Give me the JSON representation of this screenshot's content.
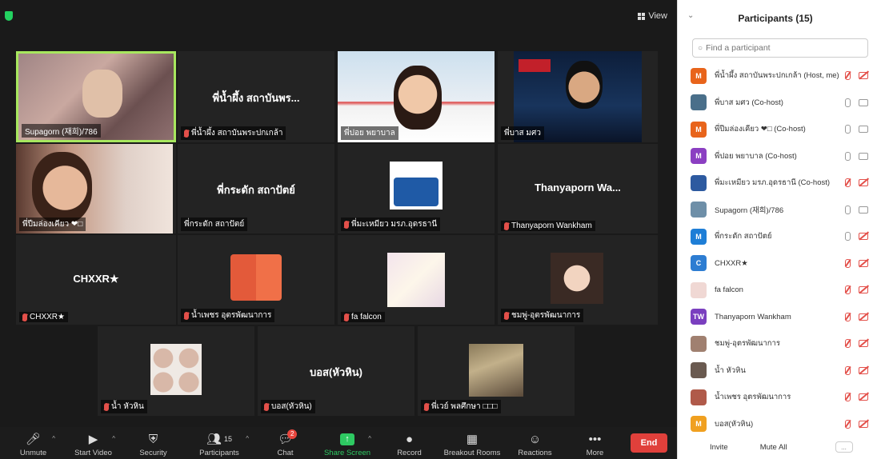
{
  "video": {
    "view_label": "View",
    "tiles": [
      {
        "name": "Supagorn (재희)/786",
        "big": "",
        "muted": false
      },
      {
        "name": "พี่น้ำผึ้ง สถาบันพระปกเกล้า",
        "big": "พี่น้ำผึ้ง สถาบันพร...",
        "muted": true
      },
      {
        "name": "พี่ปอย พยาบาล",
        "big": "",
        "muted": false
      },
      {
        "name": "พี่บาส มศว",
        "big": "",
        "muted": false
      },
      {
        "name": "พี่ปีมล่องเคียว ❤□",
        "big": "",
        "muted": false
      },
      {
        "name": "พี่กระดัก สถาปัตย์",
        "big": "พี่กระดัก สถาปัตย์",
        "muted": false
      },
      {
        "name": "พี่มะเหมียว มรภ.อุดรธานี",
        "big": "",
        "muted": true
      },
      {
        "name": "Thanyaporn Wankham",
        "big": "Thanyaporn  Wa...",
        "muted": true
      },
      {
        "name": "CHXXR★",
        "big": "CHXXR★",
        "muted": true
      },
      {
        "name": "น้ำเพชร อุตรพัฒนาการ",
        "big": "",
        "muted": true
      },
      {
        "name": "fa falcon",
        "big": "",
        "muted": true
      },
      {
        "name": "ชมพู่-อุตรพัฒนาการ",
        "big": "",
        "muted": true
      },
      {
        "name": "น้ำ หัวหิน",
        "big": "",
        "muted": true
      },
      {
        "name": "บอส(หัวหิน)",
        "big": "บอส(หัวหิน)",
        "muted": true
      },
      {
        "name": "พี่เวย์ พลศึกษา □□□",
        "big": "",
        "muted": true
      }
    ]
  },
  "toolbar": {
    "unmute": "Unmute",
    "start_video": "Start Video",
    "security": "Security",
    "participants": "Participants",
    "participants_count": "15",
    "chat": "Chat",
    "chat_badge": "2",
    "share_screen": "Share Screen",
    "record": "Record",
    "breakout": "Breakout Rooms",
    "reactions": "Reactions",
    "more": "More",
    "end": "End"
  },
  "panel": {
    "title": "Participants (15)",
    "search_placeholder": "Find a participant",
    "participants": [
      {
        "name": "พี่น้ำผึ้ง สถาบันพระปกเกล้า (Host, me)",
        "avatar": "M",
        "color": "#e8641b",
        "mic": "off",
        "cam": "off"
      },
      {
        "name": "พี่บาส มศว (Co-host)",
        "avatar": "",
        "color": "#4a6f8a",
        "mic": "on",
        "cam": "on"
      },
      {
        "name": "พี่ปีมล่องเคียว ❤□ (Co-host)",
        "avatar": "M",
        "color": "#e8641b",
        "mic": "on",
        "cam": "on"
      },
      {
        "name": "พี่ปอย พยาบาล (Co-host)",
        "avatar": "M",
        "color": "#8b3fc2",
        "mic": "on",
        "cam": "on"
      },
      {
        "name": "พี่มะเหมียว มรภ.อุดรธานี (Co-host)",
        "avatar": "",
        "color": "#2d5aa0",
        "mic": "off",
        "cam": "off"
      },
      {
        "name": "Supagorn (재희)/786",
        "avatar": "",
        "color": "#6e8fa8",
        "mic": "on",
        "cam": "on"
      },
      {
        "name": "พี่กระดัก สถาปัตย์",
        "avatar": "M",
        "color": "#1e7ed6",
        "mic": "on",
        "cam": "off"
      },
      {
        "name": "CHXXR★",
        "avatar": "C",
        "color": "#2d7dd2",
        "mic": "off",
        "cam": "off"
      },
      {
        "name": "fa falcon",
        "avatar": "",
        "color": "#f0d8d4",
        "mic": "off",
        "cam": "off"
      },
      {
        "name": "Thanyaporn Wankham",
        "avatar": "TW",
        "color": "#7a3fbf",
        "mic": "off",
        "cam": "off"
      },
      {
        "name": "ชมพู่-อุตรพัฒนาการ",
        "avatar": "",
        "color": "#a08070",
        "mic": "off",
        "cam": "off"
      },
      {
        "name": "น้ำ หัวหิน",
        "avatar": "",
        "color": "#6a5a50",
        "mic": "off",
        "cam": "off"
      },
      {
        "name": "น้ำเพชร อุตรพัฒนาการ",
        "avatar": "",
        "color": "#b05a4a",
        "mic": "off",
        "cam": "off"
      },
      {
        "name": "บอส(หัวหิน)",
        "avatar": "M",
        "color": "#f0a020",
        "mic": "off",
        "cam": "off"
      }
    ],
    "invite": "Invite",
    "mute_all": "Mute All",
    "more": "..."
  }
}
